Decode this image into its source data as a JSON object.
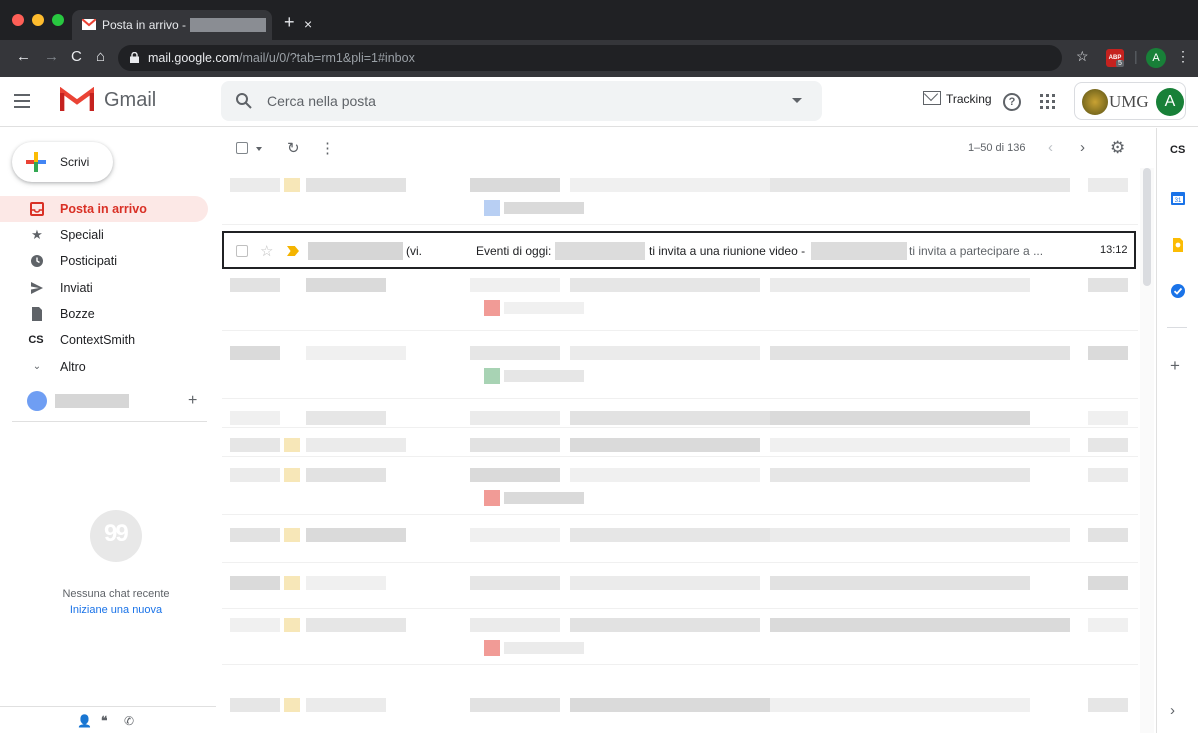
{
  "browser": {
    "tab_title": "Posta in arrivo -",
    "tab_close": "×",
    "new_tab": "+",
    "url_host": "mail.google.com",
    "url_path": "/mail/u/0/?tab=rm1&pli=1#inbox",
    "abp_label": "ABP",
    "abp_count": "5",
    "profile_initial": "A",
    "menu": "⋮",
    "bookmark": "☆"
  },
  "header": {
    "app_name": "Gmail",
    "search_placeholder": "Cerca nella posta",
    "tracking_label": "Tracking",
    "help": "?",
    "org_logo_text": "UMG",
    "avatar_initial": "A"
  },
  "sidebar": {
    "compose_label": "Scrivi",
    "items": [
      {
        "label": "Posta in arrivo",
        "icon": "inbox-icon",
        "active": true
      },
      {
        "label": "Speciali",
        "icon": "star-icon"
      },
      {
        "label": "Posticipati",
        "icon": "clock-icon"
      },
      {
        "label": "Inviati",
        "icon": "send-icon"
      },
      {
        "label": "Bozze",
        "icon": "draft-icon"
      },
      {
        "label": "ContextSmith",
        "icon": "contextsmith-icon"
      },
      {
        "label": "Altro",
        "icon": "chevron-down-icon"
      }
    ],
    "add_label": "+",
    "no_chat": "Nessuna chat recente",
    "start_new": "Iniziane una nuova"
  },
  "list": {
    "pagination": "1–50 di 136",
    "selected_email": {
      "sender_suffix": "(vi.",
      "subject_part1": "Eventi di oggi:",
      "subject_part2": "ti invita a una riunione video -",
      "snippet": "ti invita a partecipare a ...",
      "time": "13:12"
    }
  },
  "right_panel": {
    "cs_label": "CS",
    "add": "+",
    "expand": "›"
  },
  "colors": {
    "accent_red": "#d93025",
    "active_bg": "#fce8e6",
    "chrome_dark": "#202124",
    "important_marker": "#f4b400"
  }
}
